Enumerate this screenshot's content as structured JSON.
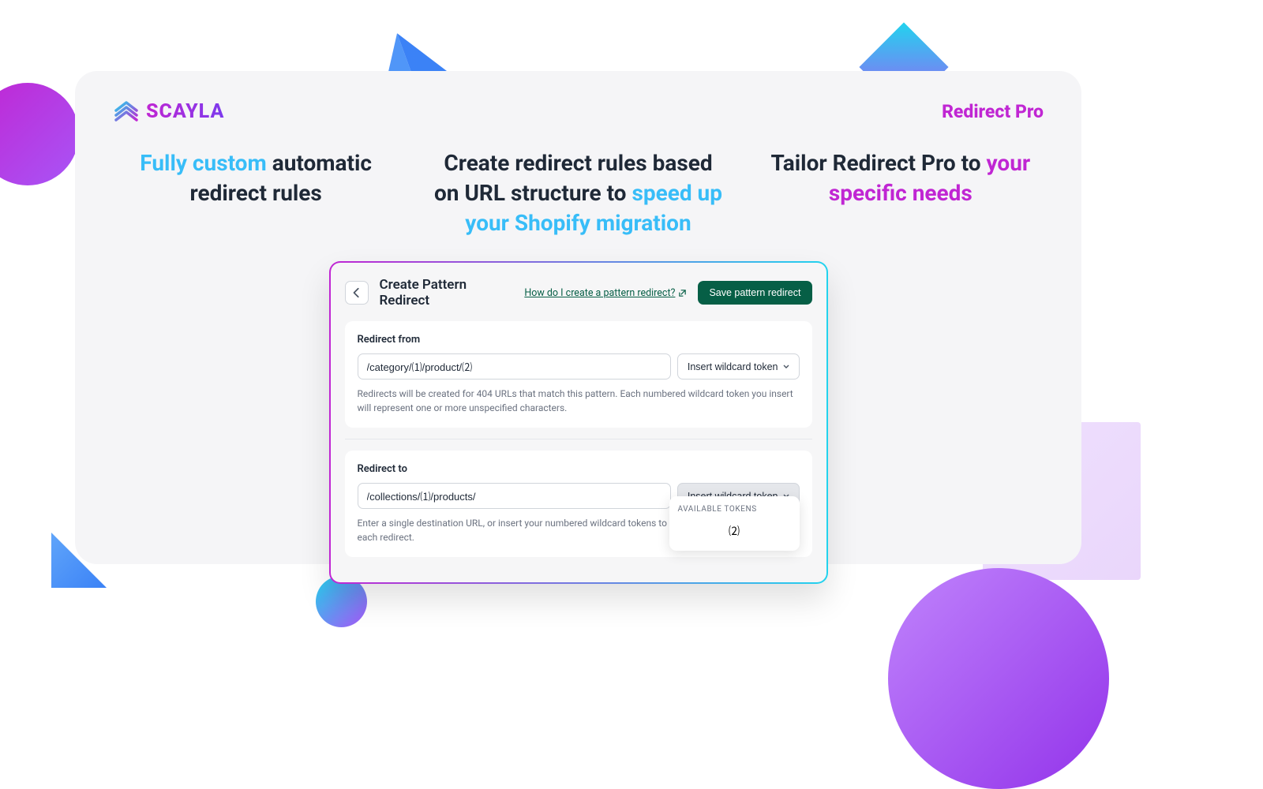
{
  "brand": {
    "name": "SCAYLA",
    "product": "Redirect Pro"
  },
  "taglines": {
    "left": {
      "hl": "Fully custom",
      "rest": "automatic redirect rules"
    },
    "mid": {
      "pre": "Create redirect rules based on URL structure to ",
      "hl": "speed up your Shopify migration"
    },
    "right": {
      "pre": "Tailor Redirect Pro to ",
      "hl": "your specific needs"
    }
  },
  "panel": {
    "title": "Create Pattern Redirect",
    "help": "How do I create a pattern redirect?",
    "save": "Save pattern redirect",
    "from": {
      "label": "Redirect from",
      "value": "/category/⑴/product/⑵",
      "button": "Insert wildcard token",
      "helper": "Redirects will be created for 404 URLs that match this pattern. Each numbered wildcard token you insert will represent one or more unspecified characters."
    },
    "to": {
      "label": "Redirect to",
      "value": "/collections/⑴/products/",
      "button": "Insert wildcard token",
      "helper": "Enter a single destination URL, or insert your numbered wildcard tokens to create a unique destination for each redirect.",
      "dropdown": {
        "header": "AVAILABLE TOKENS",
        "item": "⑵"
      }
    }
  }
}
